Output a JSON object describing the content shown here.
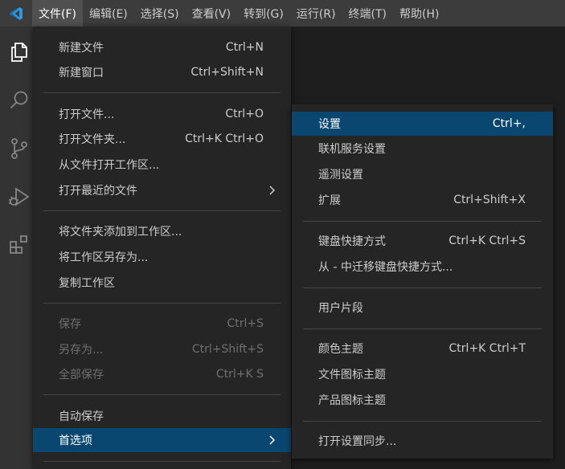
{
  "menubar": {
    "items": [
      {
        "label": "文件(F)",
        "active": true
      },
      {
        "label": "编辑(E)"
      },
      {
        "label": "选择(S)"
      },
      {
        "label": "查看(V)"
      },
      {
        "label": "转到(G)"
      },
      {
        "label": "运行(R)"
      },
      {
        "label": "终端(T)"
      },
      {
        "label": "帮助(H)"
      }
    ]
  },
  "activitybar": {
    "icons": [
      "explorer-icon",
      "search-icon",
      "source-control-icon",
      "run-debug-icon",
      "extensions-icon"
    ]
  },
  "file_menu": {
    "new_file": {
      "label": "新建文件",
      "kb": "Ctrl+N"
    },
    "new_window": {
      "label": "新建窗口",
      "kb": "Ctrl+Shift+N"
    },
    "open_file": {
      "label": "打开文件...",
      "kb": "Ctrl+O"
    },
    "open_folder": {
      "label": "打开文件夹...",
      "kb": "Ctrl+K Ctrl+O"
    },
    "open_workspace": {
      "label": "从文件打开工作区..."
    },
    "open_recent": {
      "label": "打开最近的文件"
    },
    "add_folder": {
      "label": "将文件夹添加到工作区..."
    },
    "save_workspace_as": {
      "label": "将工作区另存为..."
    },
    "duplicate_workspace": {
      "label": "复制工作区"
    },
    "save": {
      "label": "保存",
      "kb": "Ctrl+S"
    },
    "save_as": {
      "label": "另存为...",
      "kb": "Ctrl+Shift+S"
    },
    "save_all": {
      "label": "全部保存",
      "kb": "Ctrl+K S"
    },
    "auto_save": {
      "label": "自动保存"
    },
    "preferences": {
      "label": "首选项"
    }
  },
  "prefs_menu": {
    "settings": {
      "label": "设置",
      "kb": "Ctrl+,"
    },
    "online_services": {
      "label": "联机服务设置"
    },
    "telemetry": {
      "label": "遥测设置"
    },
    "extensions": {
      "label": "扩展",
      "kb": "Ctrl+Shift+X"
    },
    "keyboard_shortcuts": {
      "label": "键盘快捷方式",
      "kb": "Ctrl+K Ctrl+S"
    },
    "migrate_keymaps": {
      "label": "从 - 中迁移键盘快捷方式..."
    },
    "user_snippets": {
      "label": "用户片段"
    },
    "color_theme": {
      "label": "颜色主题",
      "kb": "Ctrl+K Ctrl+T"
    },
    "file_icon_theme": {
      "label": "文件图标主题"
    },
    "product_icon_theme": {
      "label": "产品图标主题"
    },
    "turn_on_sync": {
      "label": "打开设置同步..."
    }
  },
  "colors": {
    "menubar_bg": "#3c3c3c",
    "activitybar_bg": "#333333",
    "menu_bg": "#252526",
    "highlight": "#094771",
    "vscode_blue": "#2e9be6"
  }
}
